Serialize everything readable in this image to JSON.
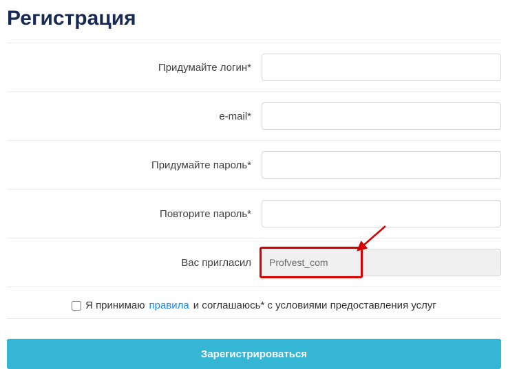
{
  "title": "Регистрация",
  "fields": {
    "login_label": "Придумайте логин*",
    "email_label": "e-mail*",
    "password_label": "Придумайте пароль*",
    "password2_label": "Повторите пароль*",
    "referrer_label": "Вас пригласил",
    "referrer_value": "Profvest_com"
  },
  "terms": {
    "pre": "Я принимаю",
    "link": "правила",
    "post": "и соглашаюсь* с условиями предоставления услуг"
  },
  "submit_label": "Зарегистрироваться"
}
